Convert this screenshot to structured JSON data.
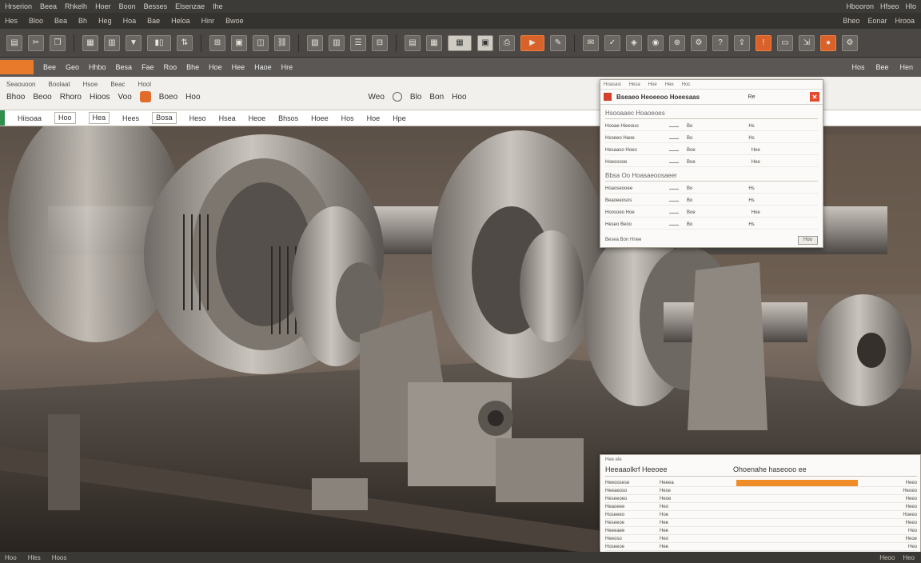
{
  "menubar": {
    "items": [
      "Hrserion",
      "Beea",
      "Rhkelh",
      "Hoer",
      "Boon",
      "Besses",
      "Elsenzae",
      "Ihe"
    ],
    "right": [
      "Hbooron",
      "Hfseo",
      "Hlo"
    ]
  },
  "tabstrip": {
    "items": [
      "Hes",
      "Bloo",
      "Bea",
      "Bh",
      "Heg",
      "Hoa",
      "Bae",
      "Heloa",
      "Hinr",
      "Bwoe"
    ],
    "right": [
      "Bheo",
      "Eonar",
      "Hrooa"
    ]
  },
  "strip2": {
    "items": [
      "Bee",
      "Geo",
      "Hhbo",
      "Besa",
      "Fae",
      "Roo",
      "Bhe",
      "Hoe",
      "Hee",
      "Haoe",
      "Hre"
    ],
    "right": [
      "Hos",
      "Bee",
      "Hen"
    ]
  },
  "docbar": {
    "row1": [
      "Seaouoon",
      "Boolaat",
      "Hsoe",
      "Beac",
      "Hool"
    ],
    "row2": [
      "Bhoo",
      "Beoo",
      "Rhoro",
      "Hioos",
      "Voo",
      "Boeo",
      "Hoo",
      "Weo",
      "Blo",
      "Bon",
      "Hoo",
      "Hoo"
    ]
  },
  "formulabar": {
    "cells": [
      "Hiisoaa",
      "Hoo",
      "Hea",
      "Hees",
      "Bosa",
      "Heso",
      "Hsea",
      "Heoe",
      "Bhsos",
      "Hoee",
      "Hos",
      "Hoe",
      "Hpe"
    ]
  },
  "statusbar": {
    "items": [
      "Hoo",
      "Hles",
      "Hoos"
    ],
    "right": [
      "Heoo",
      "Heo"
    ]
  },
  "dialog1": {
    "header": [
      "Hoasasi",
      "Hesa",
      "Hoe",
      "Hee",
      "Hoc"
    ],
    "title": "Bseaeo Heoeeoo Hoeesaas",
    "title_num": "Re",
    "section1": "Hsooaaec Hoaoeoes",
    "rows1": [
      {
        "label": "Hooae Hieeouo",
        "v1": "Bo",
        "v2": "Hs"
      },
      {
        "label": "Hsoeeo Haoe",
        "v1": "Bo",
        "v2": "Hs"
      },
      {
        "label": "Hesaaso Hoeo",
        "v1": "Boe",
        "v2": "Hoe"
      },
      {
        "label": "Hoeosooe",
        "v1": "Boe",
        "v2": "Hoe"
      }
    ],
    "section2": "Bbsa Oo Hoasaeoosaeer",
    "rows2": [
      {
        "label": "Hoaoseooee",
        "v1": "Bo",
        "v2": "Hs"
      },
      {
        "label": "Beaoeeosos",
        "v1": "Bo",
        "v2": "Hs"
      },
      {
        "label": "Hoosoeo Hoe",
        "v1": "Boe",
        "v2": "Hoe"
      },
      {
        "label": "Heseo Beoo",
        "v1": "Bo",
        "v2": "Hs"
      }
    ],
    "footer_left": "Besea Bon Hnee",
    "footer_btn": "Hoo"
  },
  "dialog2": {
    "small": "Hee ele",
    "heading_left": "Heeaaolkrf Heeoee",
    "heading_right": "Ohoenahe haseooo ee",
    "rows": [
      {
        "c1": "Heeoosese",
        "c2": "Heeea",
        "bar": 0.95,
        "c4": "Heeo"
      },
      {
        "c1": "Heeaeoso",
        "c2": "Hese",
        "bar": 0,
        "c4": "Heoeo"
      },
      {
        "c1": "Heseeoeo",
        "c2": "Heoe",
        "bar": 0,
        "c4": "Heeo"
      },
      {
        "c1": "Heaoeee",
        "c2": "Heo",
        "bar": 0,
        "c4": "Heeo"
      },
      {
        "c1": "Hoseeeo",
        "c2": "Hoe",
        "bar": 0,
        "c4": "Hoeeo"
      },
      {
        "c1": "Heseeoe",
        "c2": "Hee",
        "bar": 0,
        "c4": "Heeo"
      },
      {
        "c1": "Heeeaee",
        "c2": "Hee",
        "bar": 0,
        "c4": "Heo"
      },
      {
        "c1": "Heeoso",
        "c2": "Heo",
        "bar": 0,
        "c4": "Heoe"
      },
      {
        "c1": "Hoseeoe",
        "c2": "Hee",
        "bar": 0,
        "c4": "Heo"
      }
    ],
    "accent": "#f08c28"
  }
}
